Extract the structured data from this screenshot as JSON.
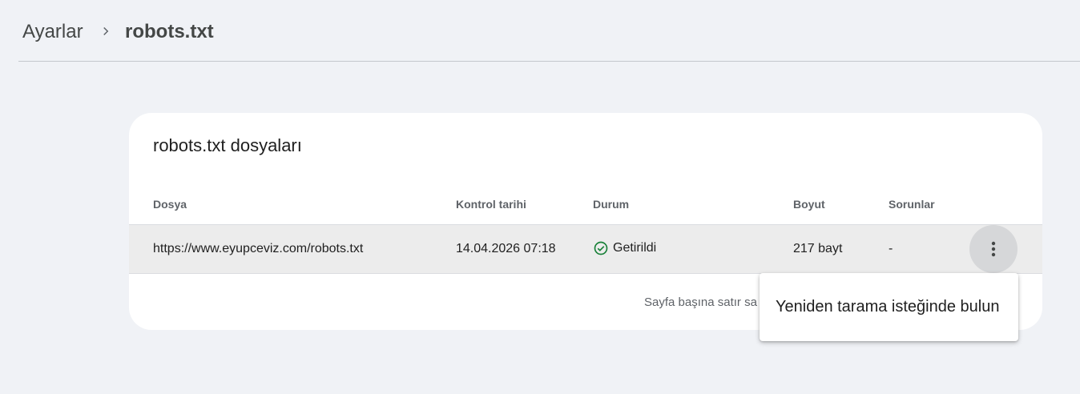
{
  "breadcrumb": {
    "parent": "Ayarlar",
    "current": "robots.txt"
  },
  "card": {
    "title": "robots.txt dosyaları",
    "columns": {
      "file": "Dosya",
      "checked": "Kontrol tarihi",
      "status": "Durum",
      "size": "Boyut",
      "issues": "Sorunlar"
    },
    "rows": [
      {
        "file": "https://www.eyupceviz.com/robots.txt",
        "checked": "14.04.2026 07:18",
        "status": "Getirildi",
        "size": "217 bayt",
        "issues": "-"
      }
    ],
    "footer": "Sayfa başına satır sa"
  },
  "menu": {
    "items": [
      "Yeniden tarama isteğinde bulun"
    ]
  },
  "colors": {
    "status_ok": "#188038",
    "background": "#f0f2f6"
  },
  "icons": {
    "separator": "chevron-right-icon",
    "status": "check-circle-icon",
    "more": "more-vert-icon"
  }
}
